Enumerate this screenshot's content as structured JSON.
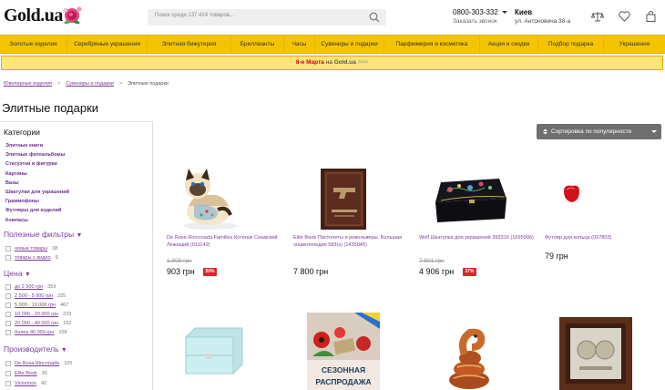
{
  "header": {
    "logo": "Gold.ua",
    "search_placeholder": "Поиск среди 137 424 товаров...",
    "phone": "0800-303-332",
    "callback": "Заказать звонок",
    "city": "Киев",
    "address": "ул. Антоновича 38-а"
  },
  "nav": [
    "Золотые изделия",
    "Серебряные украшения",
    "Элитная бижутерия",
    "Бриллианты",
    "Часы",
    "Сувениры и подарки",
    "Парфюмерия и косметика",
    "Акции и скидки",
    "Подбор подарка",
    "Украшения"
  ],
  "promo": {
    "date": "8-е Марта",
    "mid": " на ",
    "brand": "Gold.ua",
    "arrows": " >>>"
  },
  "breadcrumbs": [
    "Ювелирные изделия",
    "Сувениры и подарки",
    "Элитные подарки"
  ],
  "page_title": "Элитные подарки",
  "sidebar": {
    "categories_title": "Категории",
    "categories": [
      "Элитные книги",
      "Элитные фотоальбомы",
      "Статуэтки и фигурки",
      "Картины",
      "Вазы",
      "Шкатулки для украшений",
      "Граммофоны",
      "Футляры для изделий",
      "Компасы"
    ],
    "useful_title": "Полезные фильтры",
    "useful": [
      {
        "label": "новые товары",
        "count": "38"
      },
      {
        "label": "товары с видео",
        "count": "6"
      }
    ],
    "price_title": "Цена",
    "prices": [
      {
        "label": "до 2 500 грн",
        "count": "359"
      },
      {
        "label": "2 500 - 5 000 грн",
        "count": "325"
      },
      {
        "label": "5 000 - 10 000 грн",
        "count": "467"
      },
      {
        "label": "10 000 - 20 000 грн",
        "count": "229"
      },
      {
        "label": "20 000 - 40 000 грн",
        "count": "162"
      },
      {
        "label": "более 40 000 грн",
        "count": "109"
      }
    ],
    "maker_title": "Производитель",
    "makers": [
      {
        "label": "De Rosa Rinconada",
        "count": "105"
      },
      {
        "label": "Elite Book",
        "count": "35"
      },
      {
        "label": "Victorinox",
        "count": "42"
      }
    ]
  },
  "sort": {
    "label": "Сортировка по популярности"
  },
  "products": [
    {
      "name": "De Rosa Rinconada Families Котенок Сиамский Лежащий (011142)",
      "old_price": "1 808 грн",
      "price": "903 грн",
      "discount": "50%"
    },
    {
      "name": "Elite Book Пистолеты и револьверы. Большая энциклопедия 583(з) (1435045)",
      "old_price": "",
      "price": "7 800 грн",
      "discount": ""
    },
    {
      "name": "Wolf Шкатулка для украшений 393316 (1695906)",
      "old_price": "7 801 грн",
      "price": "4 906 грн",
      "discount": "37%"
    },
    {
      "name": "Футляр для кольца (097803)",
      "old_price": "",
      "price": "79 грн",
      "discount": ""
    }
  ],
  "banner": {
    "line1": "СЕЗОННАЯ",
    "line2": "РАСПРОДАЖА"
  },
  "colors": {
    "nav_bg": "#f5c400",
    "accent": "#7a3d9b",
    "discount": "#d9262b",
    "sort_bg": "#6f6f6f"
  }
}
